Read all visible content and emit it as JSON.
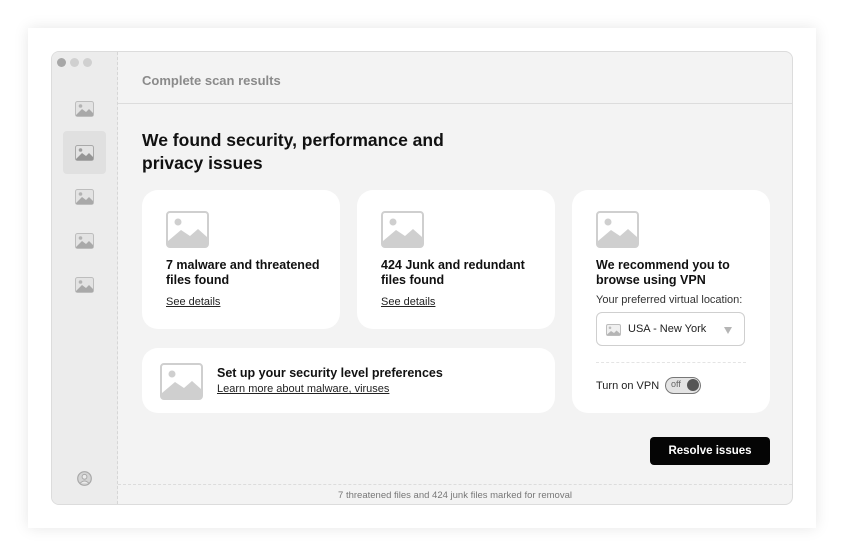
{
  "window": {
    "title": "Complete scan results",
    "traffic_lights": [
      "close",
      "minimize",
      "zoom"
    ]
  },
  "sidebar": {
    "items": [
      {
        "icon": "image-placeholder-icon",
        "active": false
      },
      {
        "icon": "image-placeholder-icon",
        "active": true
      },
      {
        "icon": "image-placeholder-icon",
        "active": false
      },
      {
        "icon": "image-placeholder-icon",
        "active": false
      },
      {
        "icon": "image-placeholder-icon",
        "active": false
      }
    ],
    "footer_icon": "user-avatar-icon"
  },
  "main": {
    "headline": "We found security, performance and privacy issues",
    "cards": [
      {
        "title": "7 malware and threatened files found",
        "link": "See details",
        "icon": "image-placeholder-icon"
      },
      {
        "title": "424 Junk and redundant files found",
        "link": "See details",
        "icon": "image-placeholder-icon"
      }
    ],
    "security_card": {
      "title": "Set up your security level preferences",
      "link": "Learn more about malware, viruses",
      "icon": "image-placeholder-icon"
    },
    "vpn_card": {
      "title": "We recommend you to browse using VPN",
      "location_label": "Your preferred virtual location:",
      "location_value": "USA - New York",
      "toggle_label": "Turn on VPN",
      "toggle_state": "off",
      "icon": "image-placeholder-icon"
    },
    "primary_button": "Resolve issues"
  },
  "statusbar": {
    "text": "7 threatened files and 424 junk files marked for removal"
  },
  "colors": {
    "window_bg": "#f3f3f3",
    "sidebar_bg": "#ececec",
    "card_bg": "#ffffff",
    "primary_button_bg": "#050505",
    "placeholder_gray": "#cfcfcf"
  }
}
